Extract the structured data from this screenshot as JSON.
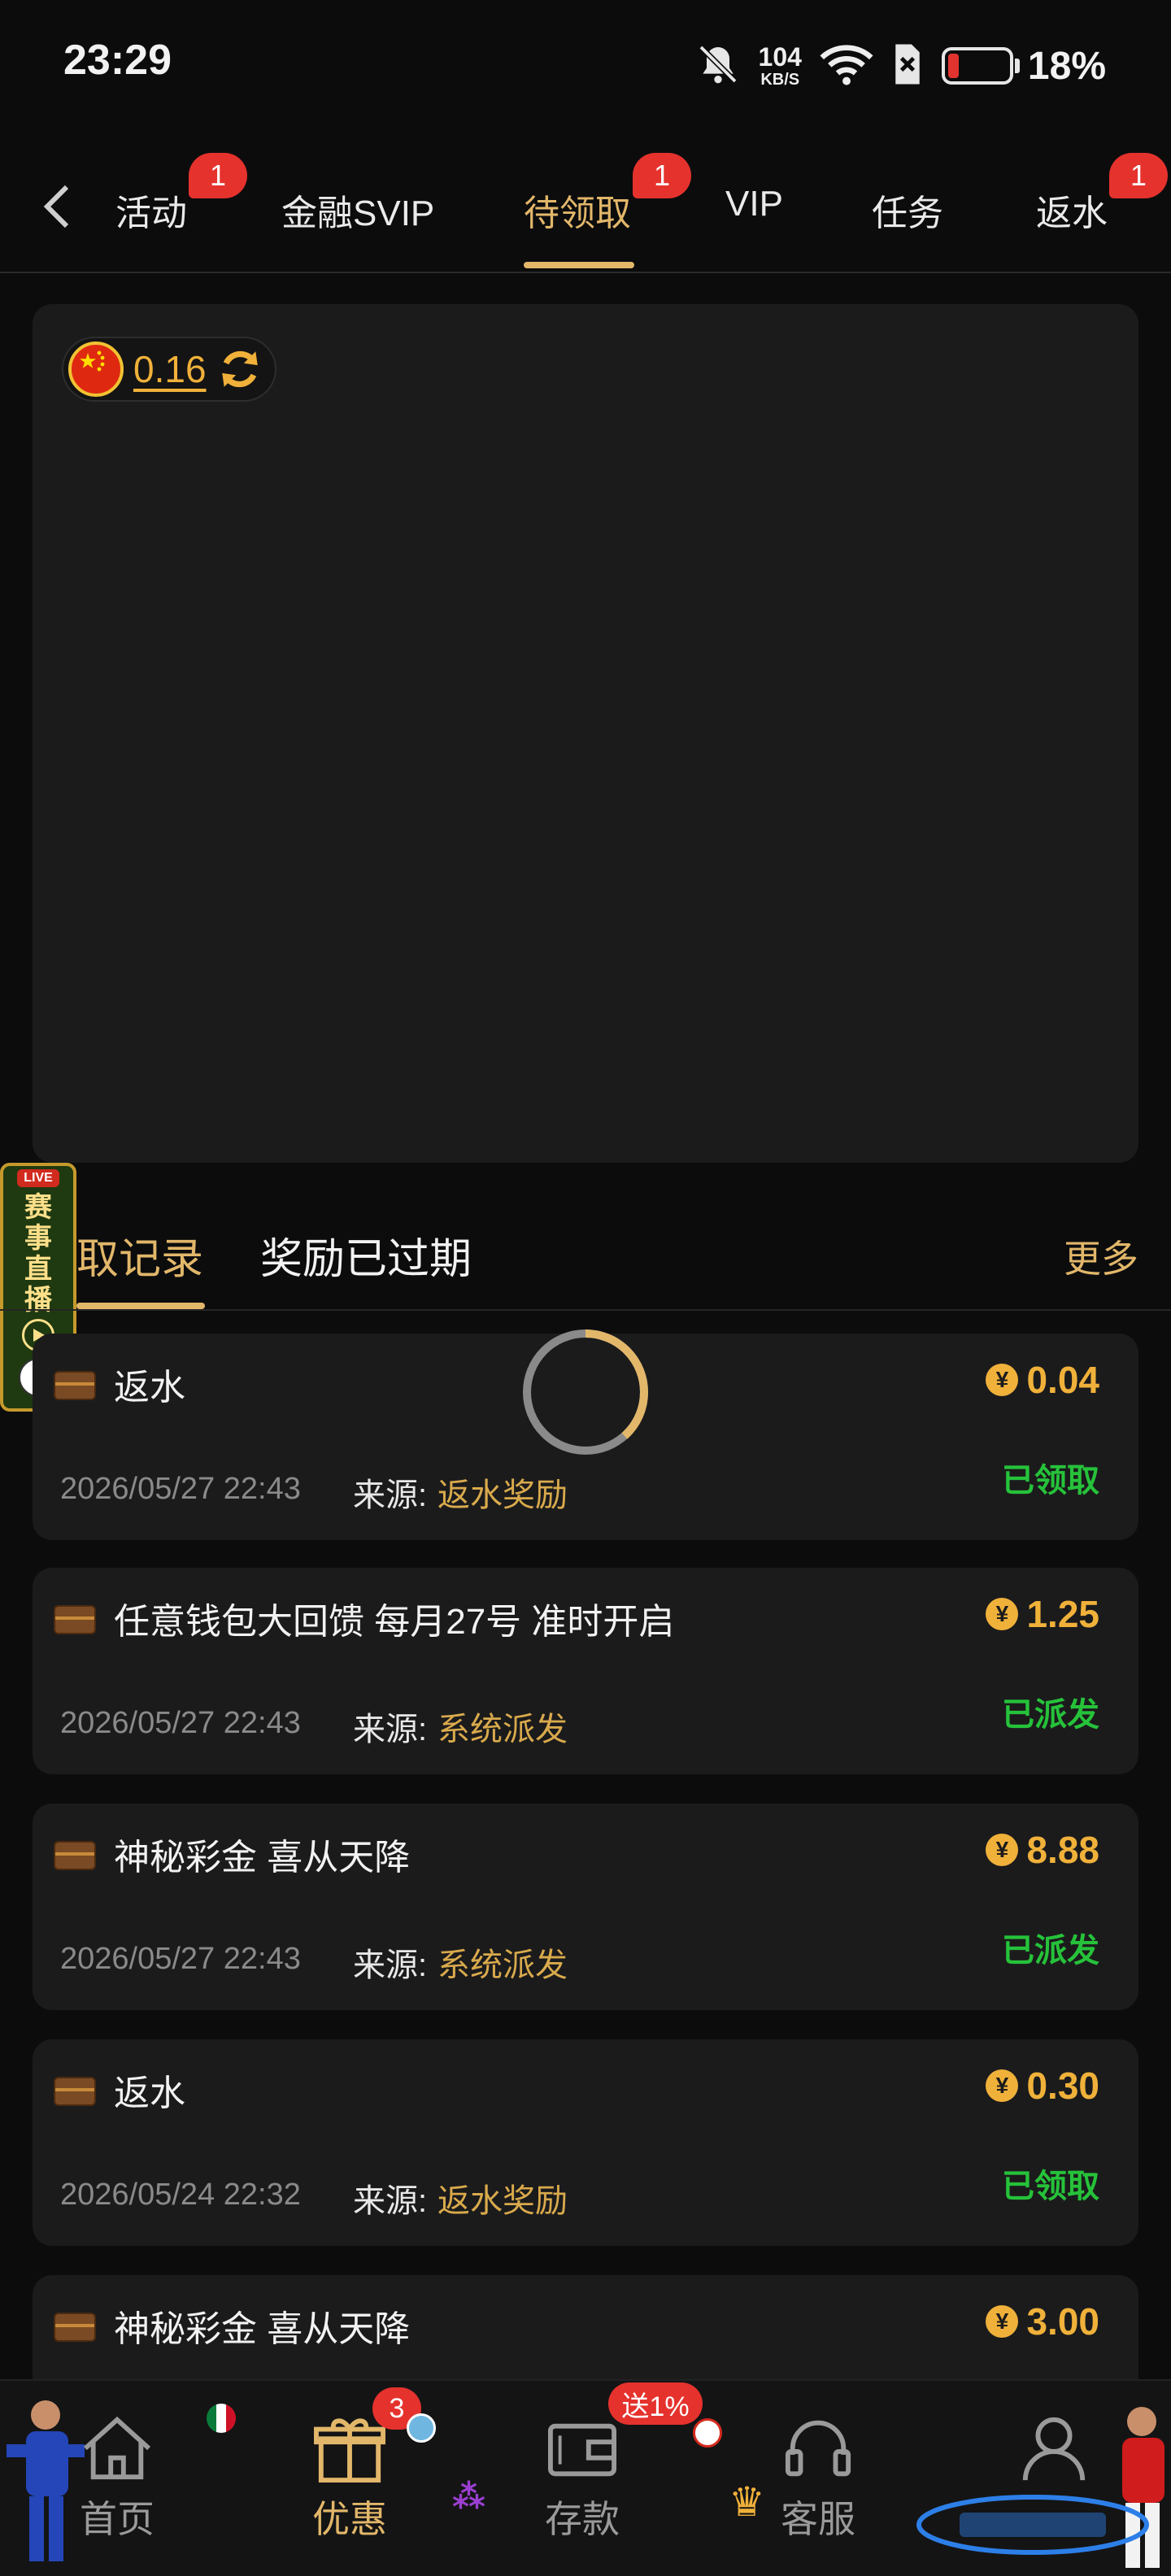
{
  "status_bar": {
    "time": "23:29",
    "speed_value": "104",
    "speed_unit": "KB/S",
    "battery_percent": "18%",
    "battery_level": 0.18
  },
  "top_tabs": {
    "items": [
      {
        "label": "活动",
        "badge": "1"
      },
      {
        "label": "金融SVIP",
        "badge": ""
      },
      {
        "label": "待领取",
        "badge": "1",
        "active": true
      },
      {
        "label": "VIP",
        "badge": ""
      },
      {
        "label": "任务",
        "badge": ""
      },
      {
        "label": "返水",
        "badge": "1"
      }
    ]
  },
  "balance": {
    "amount": "0.16"
  },
  "live_widget": {
    "tag": "LIVE",
    "text": "赛事直播"
  },
  "sub_tabs": {
    "claimed": "取记录",
    "expired": "奖励已过期",
    "more": "更多"
  },
  "records": [
    {
      "title": "返水",
      "amount": "0.04",
      "date": "2026/05/27 22:43",
      "source_label": "来源:",
      "source": "返水奖励",
      "status": "已领取"
    },
    {
      "title": "任意钱包大回馈 每月27号 准时开启",
      "amount": "1.25",
      "date": "2026/05/27 22:43",
      "source_label": "来源:",
      "source": "系统派发",
      "status": "已派发"
    },
    {
      "title": "神秘彩金 喜从天降",
      "amount": "8.88",
      "date": "2026/05/27 22:43",
      "source_label": "来源:",
      "source": "系统派发",
      "status": "已派发"
    },
    {
      "title": "返水",
      "amount": "0.30",
      "date": "2026/05/24 22:32",
      "source_label": "来源:",
      "source": "返水奖励",
      "status": "已领取"
    },
    {
      "title": "神秘彩金 喜从天降",
      "amount": "3.00"
    }
  ],
  "bottom_nav": {
    "home": "首页",
    "promo": "优惠",
    "promo_badge": "3",
    "deposit": "存款",
    "deposit_badge": "送1%",
    "service": "客服",
    "profile": ""
  },
  "currency_symbol": "¥",
  "colors": {
    "accent_gold": "#e2b76a",
    "amount_gold": "#f0b13a",
    "status_green": "#26c23a",
    "badge_red": "#e5322d",
    "card_bg": "#1b1b1c",
    "page_bg": "#0c0c0d"
  }
}
